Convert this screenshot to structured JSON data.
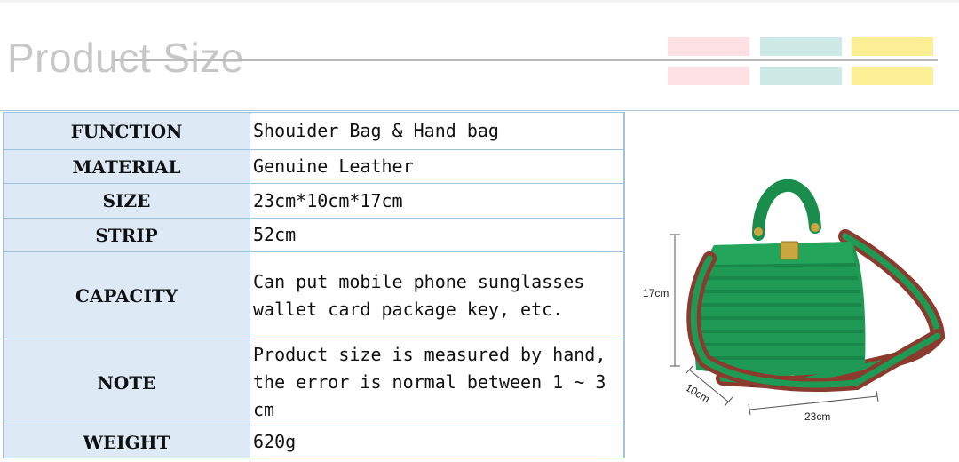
{
  "header": {
    "title": "Product Size",
    "swatch_colors": [
      "#fde1e4",
      "#cdeae7",
      "#fbef96"
    ]
  },
  "specs": [
    {
      "label": "FUNCTION",
      "value": "Shouider Bag & Hand bag"
    },
    {
      "label": "MATERIAL",
      "value": "Genuine Leather"
    },
    {
      "label": "SIZE",
      "value": "23cm*10cm*17cm"
    },
    {
      "label": "STRIP",
      "value": "52cm"
    },
    {
      "label": "CAPACITY",
      "value": "Can put mobile phone sunglasses wallet card package key, etc."
    },
    {
      "label": "NOTE",
      "value": "Product size is measured by hand, the error is normal between 1 ~ 3 cm"
    },
    {
      "label": "WEIGHT",
      "value": "620g"
    }
  ],
  "dimensions": {
    "height": "17cm",
    "depth": "10cm",
    "width": "23cm"
  },
  "colors": {
    "bag_green": "#1f9a55",
    "strap_brown": "#8a3b2e"
  }
}
